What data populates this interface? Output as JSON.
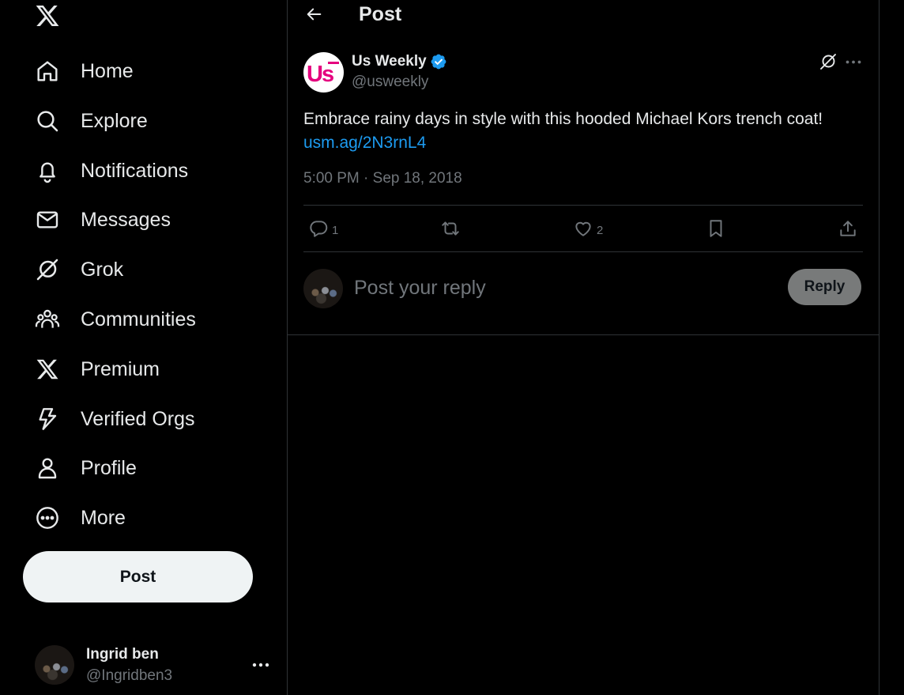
{
  "sidebar": {
    "logo_icon": "x-logo-icon",
    "nav": [
      {
        "label": "Home",
        "icon": "home-icon"
      },
      {
        "label": "Explore",
        "icon": "search-icon"
      },
      {
        "label": "Notifications",
        "icon": "bell-icon"
      },
      {
        "label": "Messages",
        "icon": "envelope-icon"
      },
      {
        "label": "Grok",
        "icon": "grok-icon"
      },
      {
        "label": "Communities",
        "icon": "communities-icon"
      },
      {
        "label": "Premium",
        "icon": "x-premium-icon"
      },
      {
        "label": "Verified Orgs",
        "icon": "lightning-icon"
      },
      {
        "label": "Profile",
        "icon": "person-icon"
      },
      {
        "label": "More",
        "icon": "more-circle-icon"
      }
    ],
    "post_button": "Post",
    "account": {
      "name": "Ingrid ben",
      "handle": "@Ingridben3"
    }
  },
  "header": {
    "title": "Post"
  },
  "tweet": {
    "author_name": "Us Weekly",
    "author_handle": "@usweekly",
    "avatar_text": "Us",
    "text": "Embrace rainy days in style with this hooded Michael Kors trench coat!",
    "link": "usm.ag/2N3rnL4",
    "timestamp": "5:00 PM · Sep 18, 2018",
    "replies": "1",
    "likes": "2"
  },
  "reply_box": {
    "placeholder": "Post your reply",
    "button": "Reply"
  },
  "colors": {
    "background": "#000000",
    "text": "#e7e9ea",
    "muted": "#71767b",
    "accent": "#1d9bf0",
    "border": "#2f3336",
    "us_weekly_pink": "#e5007e"
  }
}
